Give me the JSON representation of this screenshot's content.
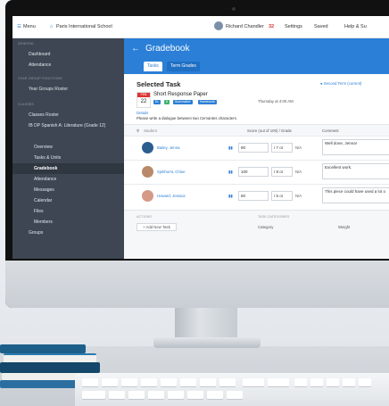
{
  "topbar": {
    "menu": "Menu",
    "school": "Paris International School",
    "user": "Richard Chandler",
    "count": "32",
    "settings": "Settings",
    "saved": "Saved",
    "help": "Help & Su"
  },
  "sidebar": {
    "section_general": "GENERAL",
    "dashboard": "Dashboard",
    "attendance": "Attendance",
    "section_groups": "YEAR GROUP FUNCTIONS",
    "year_groups": "Year Groups Roster",
    "section_classes": "CLASSES",
    "classes_roster": "Classes Roster",
    "class_name": "IB DP Spanish A: Literature (Grade 12)",
    "items": [
      "Overview",
      "Tasks & Units",
      "Gradebook",
      "Attendance",
      "Messages",
      "Calendar",
      "Files",
      "Members",
      "Groups"
    ]
  },
  "main": {
    "back": "←",
    "title": "Gradebook",
    "tabs": [
      "Tasks",
      "Term Grades"
    ],
    "selected_task": "Selected Task",
    "term": "Second Term (current)",
    "month": "FEB",
    "day": "22",
    "task_title": "Short Response Paper",
    "badges": [
      "EL",
      "5",
      "Summative",
      "Homework"
    ],
    "due": "Thursday at 4:00 AM",
    "details_label": "Details",
    "details_text": "Please write a dialogue between two Cervantes characters.",
    "col_student": "Student",
    "col_score": "Score (out of 100) / Grade",
    "col_comment": "Comment",
    "students": [
      {
        "name": "Bailey, Jenna",
        "score": "90",
        "grade": "7",
        "comment": "Well done, Jenna!"
      },
      {
        "name": "Sjekhorst, Chloe",
        "score": "100",
        "grade": "8",
        "comment": "Excellent work."
      },
      {
        "name": "Howard, Jessica",
        "score": "60",
        "grade": "5",
        "comment": "This piece could have used a lot o"
      }
    ],
    "footer_actions": "ACTIONS",
    "footer_add": "Add New Task",
    "footer_cat_head": "TASK CATEGORIES",
    "footer_category": "Category",
    "footer_weight": "Weight"
  }
}
